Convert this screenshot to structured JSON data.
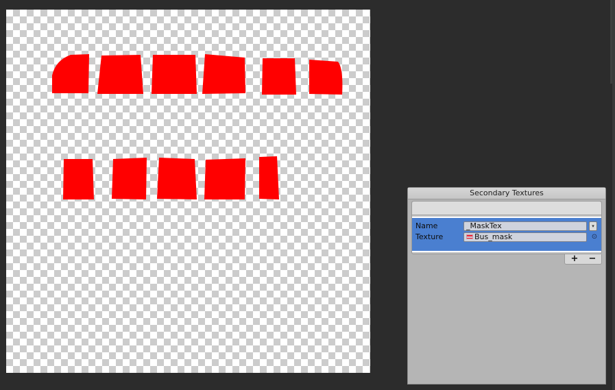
{
  "panel": {
    "title": "Secondary Textures",
    "name_label": "Name",
    "name_value": "_MaskTex",
    "texture_label": "Texture",
    "texture_value": "Bus_mask",
    "add_label": "+",
    "remove_label": "−",
    "dropdown_glyph": "▾",
    "picker_glyph": "⊙"
  },
  "preview": {
    "mask_color": "#ff0000",
    "background": "transparent checkerboard"
  }
}
